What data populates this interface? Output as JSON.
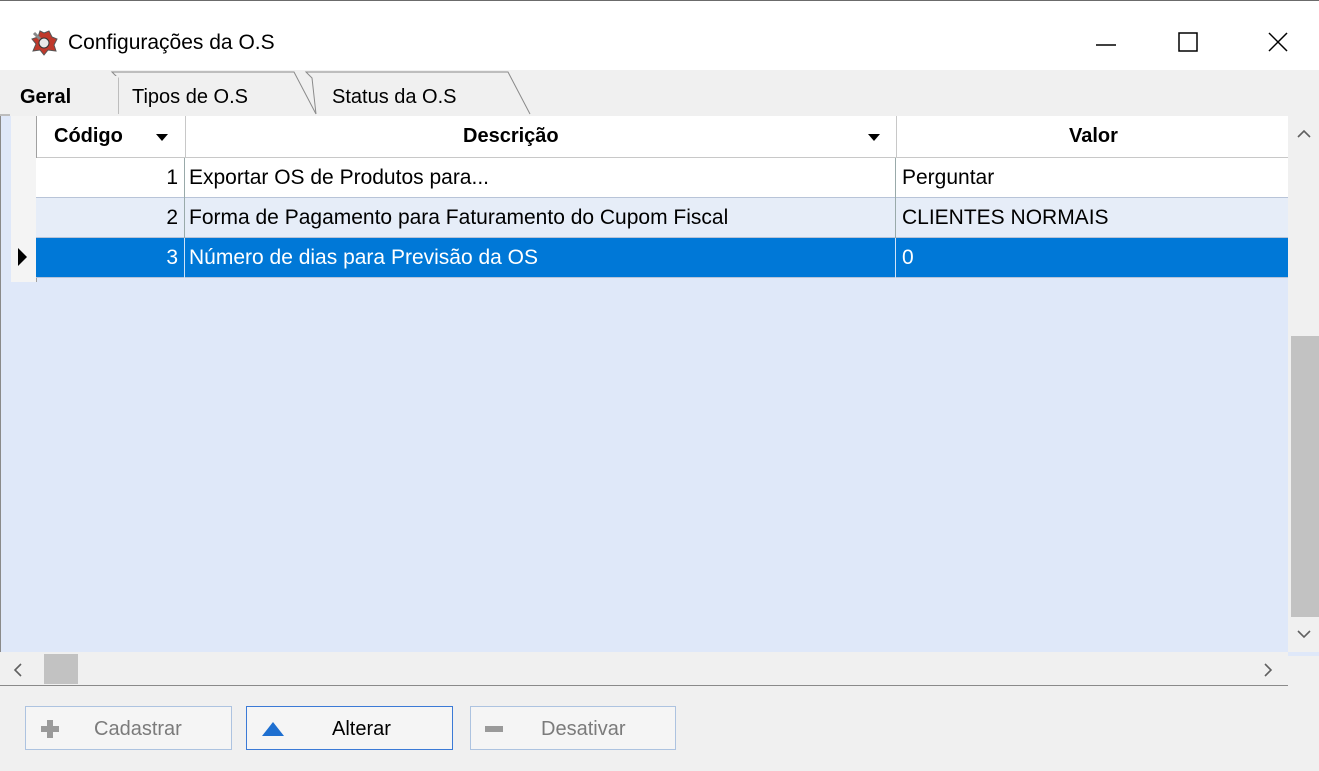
{
  "window": {
    "title": "Configurações da O.S",
    "icon": "app-icon",
    "controls": [
      "minimize-icon",
      "maximize-icon",
      "close-icon"
    ]
  },
  "tabs": [
    {
      "label": "Geral",
      "active": true
    },
    {
      "label": "Tipos de O.S",
      "active": false
    },
    {
      "label": "Status da O.S",
      "active": false
    }
  ],
  "grid": {
    "columns": [
      "Código",
      "Descrição",
      "Valor"
    ],
    "rows": [
      {
        "codigo": "1",
        "descricao": "Exportar OS de Produtos para...",
        "valor": "Perguntar"
      },
      {
        "codigo": "2",
        "descricao": "Forma de Pagamento para Faturamento do Cupom Fiscal",
        "valor": "CLIENTES NORMAIS"
      },
      {
        "codigo": "3",
        "descricao": "Número de dias para Previsão da OS",
        "valor": "0"
      }
    ],
    "selected_row": 3
  },
  "buttons": {
    "cadastrar": "Cadastrar",
    "alterar": "Alterar",
    "desativar": "Desativar"
  },
  "colors": {
    "selection": "#0078d7",
    "grid_background": "#dfe8f9",
    "alterar_icon": "#1e6fd0"
  }
}
